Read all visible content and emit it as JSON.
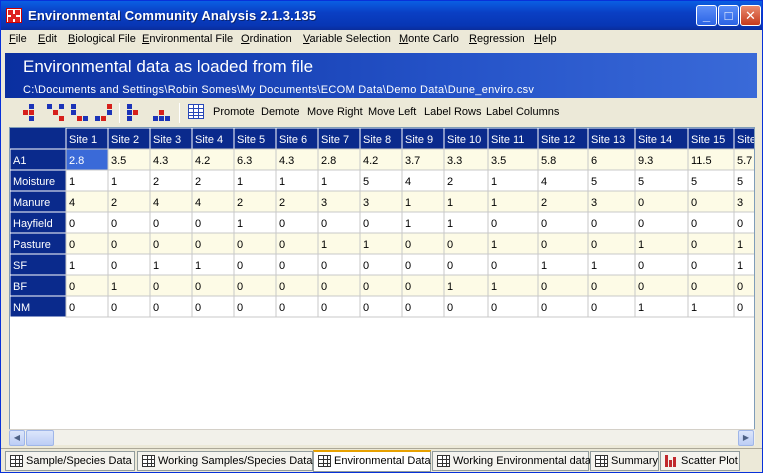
{
  "window": {
    "title": "Environmental Community Analysis 2.1.3.135",
    "min_label": "_",
    "max_label": "□",
    "close_label": "✕"
  },
  "menu": [
    "File",
    "Edit",
    "Biological File",
    "Environmental File",
    "Ordination",
    "Variable Selection",
    "Monte Carlo",
    "Regression",
    "Help"
  ],
  "banner": {
    "title": "Environmental data as loaded from file",
    "path": "C:\\Documents and Settings\\Robin Somes\\My Documents\\ECOM Data\\Demo Data\\Dune_enviro.csv"
  },
  "toolbar": {
    "icons": [
      "promote-row-icon",
      "demote-row-icon",
      "move-right-icon",
      "move-left-icon",
      "move-up-icon",
      "move-down-icon"
    ],
    "buttons": [
      "Promote",
      "Demote",
      "Move Right",
      "Move Left",
      "Label Rows",
      "Label Columns"
    ]
  },
  "table": {
    "columns": [
      "Site 1",
      "Site 2",
      "Site 3",
      "Site 4",
      "Site 5",
      "Site 6",
      "Site 7",
      "Site 8",
      "Site 9",
      "Site 10",
      "Site 11",
      "Site 12",
      "Site 13",
      "Site 14",
      "Site 15",
      "Site"
    ],
    "rows": [
      {
        "label": "A1",
        "values": [
          "2.8",
          "3.5",
          "4.3",
          "4.2",
          "6.3",
          "4.3",
          "2.8",
          "4.2",
          "3.7",
          "3.3",
          "3.5",
          "5.8",
          "6",
          "9.3",
          "11.5",
          "5.7"
        ]
      },
      {
        "label": "Moisture",
        "values": [
          "1",
          "1",
          "2",
          "2",
          "1",
          "1",
          "1",
          "5",
          "4",
          "2",
          "1",
          "4",
          "5",
          "5",
          "5",
          "5"
        ]
      },
      {
        "label": "Manure",
        "values": [
          "4",
          "2",
          "4",
          "4",
          "2",
          "2",
          "3",
          "3",
          "1",
          "1",
          "1",
          "2",
          "3",
          "0",
          "0",
          "3"
        ]
      },
      {
        "label": "Hayfield",
        "values": [
          "0",
          "0",
          "0",
          "0",
          "1",
          "0",
          "0",
          "0",
          "1",
          "1",
          "0",
          "0",
          "0",
          "0",
          "0",
          "0"
        ]
      },
      {
        "label": "Pasture",
        "values": [
          "0",
          "0",
          "0",
          "0",
          "0",
          "0",
          "1",
          "1",
          "0",
          "0",
          "1",
          "0",
          "0",
          "1",
          "0",
          "1"
        ]
      },
      {
        "label": "SF",
        "values": [
          "1",
          "0",
          "1",
          "1",
          "0",
          "0",
          "0",
          "0",
          "0",
          "0",
          "0",
          "1",
          "1",
          "0",
          "0",
          "1"
        ]
      },
      {
        "label": "BF",
        "values": [
          "0",
          "1",
          "0",
          "0",
          "0",
          "0",
          "0",
          "0",
          "0",
          "1",
          "1",
          "0",
          "0",
          "0",
          "0",
          "0"
        ]
      },
      {
        "label": "NM",
        "values": [
          "0",
          "0",
          "0",
          "0",
          "0",
          "0",
          "0",
          "0",
          "0",
          "0",
          "0",
          "0",
          "0",
          "1",
          "1",
          "0"
        ]
      }
    ],
    "selected_cell": "A1 / Site 1",
    "colors": {
      "header": "#0a2a8c",
      "band": "#fdfbe6",
      "selected": "#3a6ad8"
    }
  },
  "scrollbar": {
    "left_arrow": "◀",
    "right_arrow": "▶"
  },
  "tabs": [
    "Sample/Species Data",
    "Working Samples/Species Data",
    "Environmental Data",
    "Working Environmental data",
    "Summary",
    "Scatter Plot"
  ],
  "active_tab": "Environmental Data",
  "colors": {
    "title_bar": "#0a3fc4",
    "banner": "#2553c8"
  }
}
